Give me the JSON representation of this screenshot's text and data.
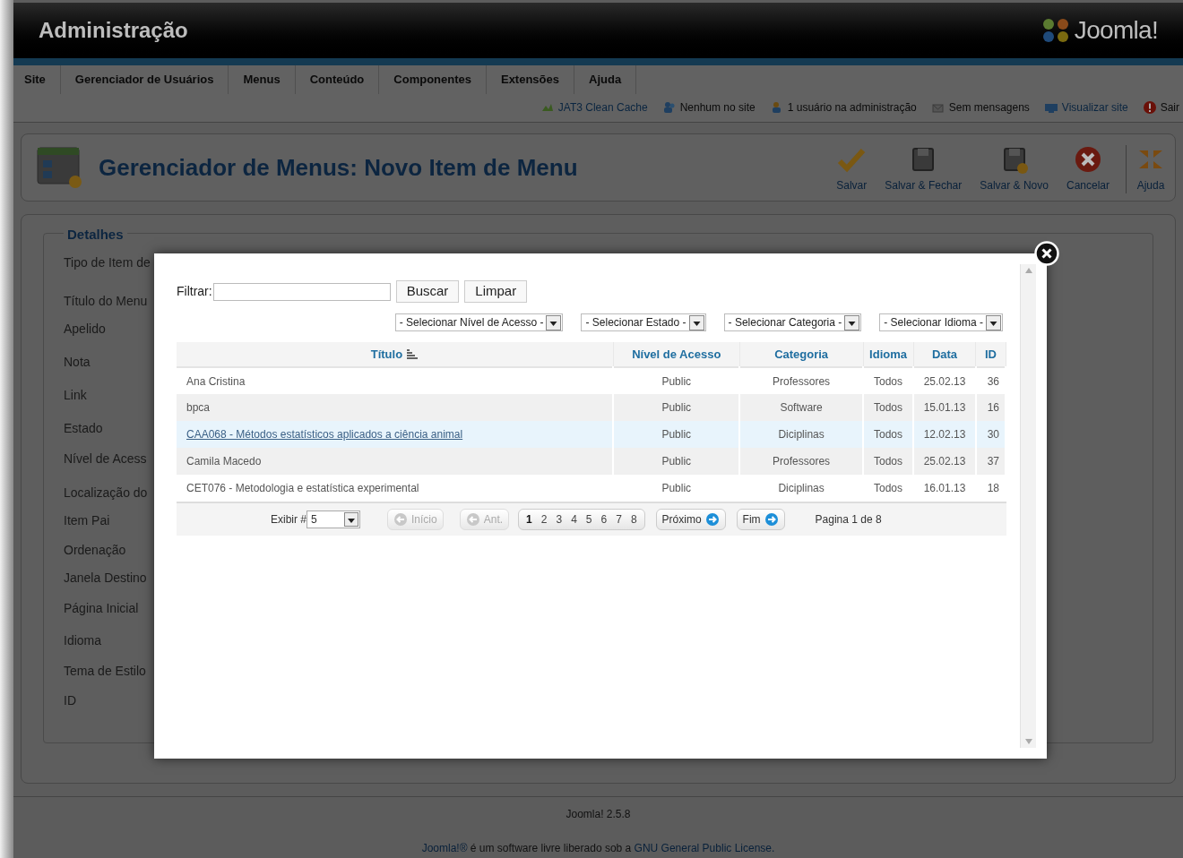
{
  "header": {
    "title": "Administração",
    "logo_text": "Joomla!"
  },
  "menu": [
    "Site",
    "Gerenciador de Usuários",
    "Menus",
    "Conteúdo",
    "Componentes",
    "Extensões",
    "Ajuda"
  ],
  "status": [
    {
      "kind": "cache",
      "text": "JAT3 Clean Cache",
      "link": true
    },
    {
      "kind": "users",
      "text": "Nenhum no site",
      "link": false
    },
    {
      "kind": "admins",
      "text": "1 usuário na administração",
      "link": false
    },
    {
      "kind": "messages",
      "text": "Sem mensagens",
      "link": false
    },
    {
      "kind": "view",
      "text": "Visualizar site",
      "link": true
    },
    {
      "kind": "logout",
      "text": "Sair",
      "link": false
    }
  ],
  "toolbar": {
    "title": "Gerenciador de Menus: Novo Item de Menu",
    "buttons": [
      {
        "kind": "save",
        "label": "Salvar"
      },
      {
        "kind": "save_close",
        "label": "Salvar & Fechar"
      },
      {
        "kind": "save_new",
        "label": "Salvar & Novo"
      },
      {
        "kind": "cancel",
        "label": "Cancelar"
      },
      {
        "kind": "help",
        "label": "Ajuda"
      }
    ]
  },
  "details": {
    "legend": "Detalhes",
    "fields": [
      "Tipo de Item de",
      "Título do Menu",
      "Apelido",
      "Nota",
      "Link",
      "Estado",
      "Nível de Acess",
      "Localização do",
      "Item Pai",
      "Ordenação",
      "Janela Destino",
      "Página Inicial",
      "Idioma",
      "Tema de Estilo",
      "ID"
    ]
  },
  "modal": {
    "filter_label": "Filtrar:",
    "buttons": [
      "Buscar",
      "Limpar"
    ],
    "selects": [
      "- Selecionar Nível de Acesso -",
      "- Selecionar Estado -",
      "- Selecionar Categoria -",
      "- Selecionar Idioma -"
    ],
    "columns": [
      {
        "label": "Título",
        "sorted": true
      },
      {
        "label": "Nível de Acesso",
        "sorted": false
      },
      {
        "label": "Categoria",
        "sorted": false
      },
      {
        "label": "Idioma",
        "sorted": false
      },
      {
        "label": "Data",
        "sorted": false
      },
      {
        "label": "ID",
        "sorted": false
      }
    ],
    "rows": [
      {
        "hovered": false,
        "cells": [
          "Ana Cristina",
          "Public",
          "Professores",
          "Todos",
          "25.02.13",
          "36"
        ]
      },
      {
        "hovered": false,
        "cells": [
          "bpca",
          "Public",
          "Software",
          "Todos",
          "15.01.13",
          "16"
        ]
      },
      {
        "hovered": true,
        "cells": [
          "CAA068 - Métodos estatísticos aplicados a ciência animal",
          "Public",
          "Diciplinas",
          "Todos",
          "12.02.13",
          "30"
        ]
      },
      {
        "hovered": false,
        "cells": [
          "Camila Macedo",
          "Public",
          "Professores",
          "Todos",
          "25.02.13",
          "37"
        ]
      },
      {
        "hovered": false,
        "cells": [
          "CET076 - Metodologia e estatística experimental",
          "Public",
          "Diciplinas",
          "Todos",
          "16.01.13",
          "18"
        ]
      }
    ],
    "pagination": {
      "show_label": "Exibir #",
      "show_value": "5",
      "nav": [
        {
          "label": "Início",
          "disabled": true
        },
        {
          "label": "Ant.",
          "disabled": true
        }
      ],
      "pages": [
        {
          "label": "1",
          "selected": true
        },
        {
          "label": "2",
          "selected": false
        },
        {
          "label": "3",
          "selected": false
        },
        {
          "label": "4",
          "selected": false
        },
        {
          "label": "5",
          "selected": false
        },
        {
          "label": "6",
          "selected": false
        },
        {
          "label": "7",
          "selected": false
        },
        {
          "label": "8",
          "selected": false
        }
      ],
      "nav_end": [
        {
          "label": "Próximo",
          "disabled": false
        },
        {
          "label": "Fim",
          "disabled": false
        }
      ],
      "page_info": "Pagina 1 de 8"
    }
  },
  "footer": {
    "version": "Joomla! 2.5.8",
    "license": [
      {
        "kind": "link",
        "text": "Joomla!®"
      },
      {
        "kind": "text",
        "text": " é um software livre liberado sob a "
      },
      {
        "kind": "link",
        "text": "GNU General Public License."
      }
    ]
  }
}
